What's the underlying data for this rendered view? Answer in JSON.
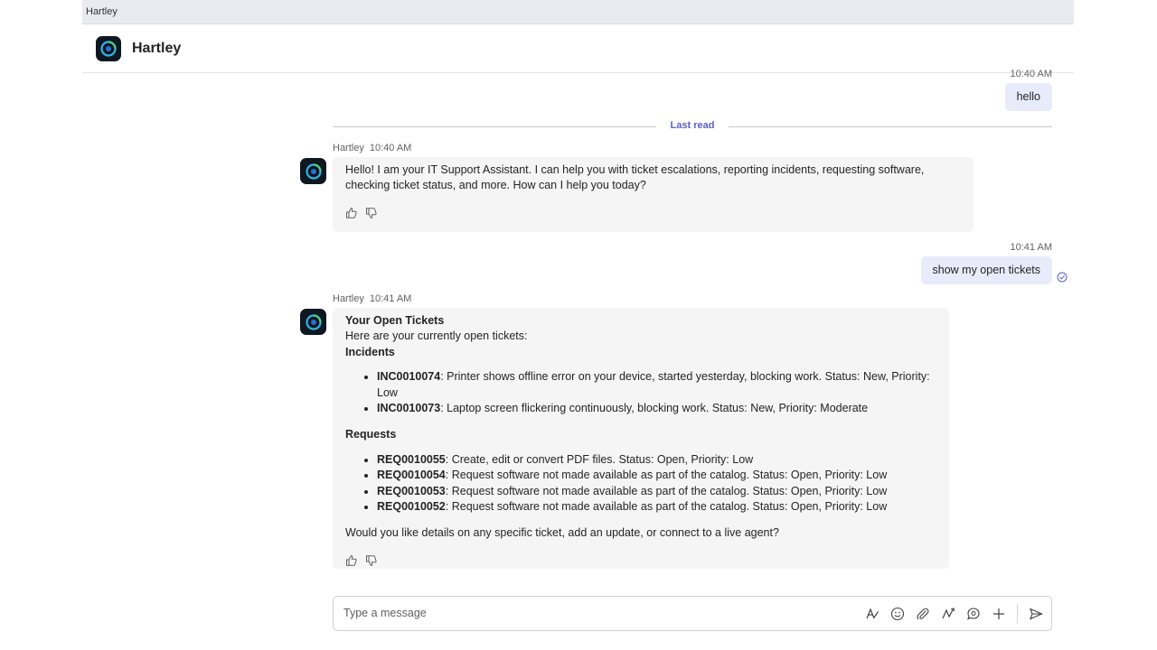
{
  "window": {
    "title": "Hartley"
  },
  "app": {
    "name": "Hartley"
  },
  "messages": {
    "first_user": {
      "time": "10:40 AM",
      "text": "hello"
    },
    "divider_label": "Last read",
    "bot1": {
      "sender": "Hartley",
      "time": "10:40 AM",
      "text": "Hello! I am your IT Support Assistant. I can help you with ticket escalations, reporting incidents, requesting software, checking ticket status, and more. How can I help you today?"
    },
    "second_user": {
      "time": "10:41 AM",
      "text": "show my open tickets"
    },
    "bot2": {
      "sender": "Hartley",
      "time": "10:41 AM",
      "title": "Your Open Tickets",
      "intro": "Here are your currently open tickets:",
      "incidents_label": "Incidents",
      "incidents": [
        {
          "id": "INC0010074",
          "text": ": Printer shows offline error on your device, started yesterday, blocking work. Status: New, Priority: Low"
        },
        {
          "id": "INC0010073",
          "text": ": Laptop screen flickering continuously, blocking work. Status: New, Priority: Moderate"
        }
      ],
      "requests_label": "Requests",
      "requests": [
        {
          "id": "REQ0010055",
          "text": ": Create, edit or convert PDF files. Status: Open, Priority: Low"
        },
        {
          "id": "REQ0010054",
          "text": ": Request software not made available as part of the catalog. Status: Open, Priority: Low"
        },
        {
          "id": "REQ0010053",
          "text": ": Request software not made available as part of the catalog. Status: Open, Priority: Low"
        },
        {
          "id": "REQ0010052",
          "text": ": Request software not made available as part of the catalog. Status: Open, Priority: Low"
        }
      ],
      "closing": "Would you like details on any specific ticket, add an update, or connect to a live agent?"
    }
  },
  "composer": {
    "placeholder": "Type a message",
    "tools": [
      "format-icon",
      "emoji-icon",
      "attach-icon",
      "loop-icon",
      "chat-bubble-icon",
      "plus-icon",
      "send-icon"
    ]
  },
  "colors": {
    "accent": "#5b5fc7",
    "user_bubble": "#e8ebfa",
    "bot_bubble": "#f5f5f5",
    "logo_bg": "#0f1720"
  }
}
